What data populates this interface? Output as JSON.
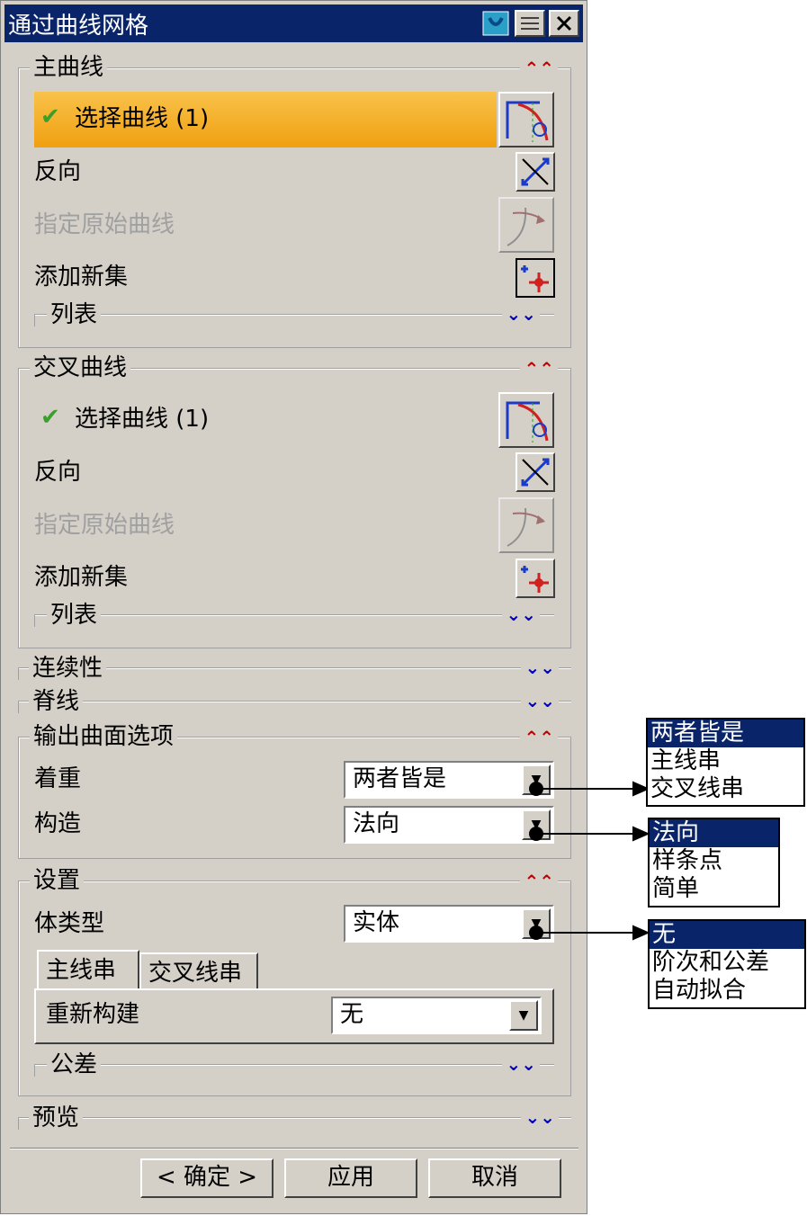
{
  "window": {
    "title": "通过曲线网格"
  },
  "primary_curves": {
    "title": "主曲线",
    "select_label": "选择曲线 (1)",
    "reverse_label": "反向",
    "specify_origin_label": "指定原始曲线",
    "add_set_label": "添加新集",
    "list_label": "列表"
  },
  "cross_curves": {
    "title": "交叉曲线",
    "select_label": "选择曲线 (1)",
    "reverse_label": "反向",
    "specify_origin_label": "指定原始曲线",
    "add_set_label": "添加新集",
    "list_label": "列表"
  },
  "continuity": {
    "title": "连续性"
  },
  "spine": {
    "title": "脊线"
  },
  "output_options": {
    "title": "输出曲面选项",
    "emphasis_label": "着重",
    "emphasis_value": "两者皆是",
    "construction_label": "构造",
    "construction_value": "法向"
  },
  "settings": {
    "title": "设置",
    "body_type_label": "体类型",
    "body_type_value": "实体",
    "tabs": [
      "主线串",
      "交叉线串"
    ],
    "rebuild_label": "重新构建",
    "rebuild_value": "无",
    "tolerance_label": "公差"
  },
  "preview": {
    "title": "预览"
  },
  "buttons": {
    "ok": "< 确定 >",
    "apply": "应用",
    "cancel": "取消"
  },
  "popups": {
    "emphasis_options": [
      "两者皆是",
      "主线串",
      "交叉线串"
    ],
    "construction_options": [
      "法向",
      "样条点",
      "简单"
    ],
    "rebuild_options": [
      "无",
      "阶次和公差",
      "自动拟合"
    ]
  },
  "icons": [
    "help-icon",
    "menu-icon",
    "close-icon",
    "select-curve-icon",
    "reverse-icon",
    "origin-curve-icon",
    "add-set-icon",
    "expand-icon",
    "collapse-icon",
    "dropdown-arrow-icon"
  ]
}
